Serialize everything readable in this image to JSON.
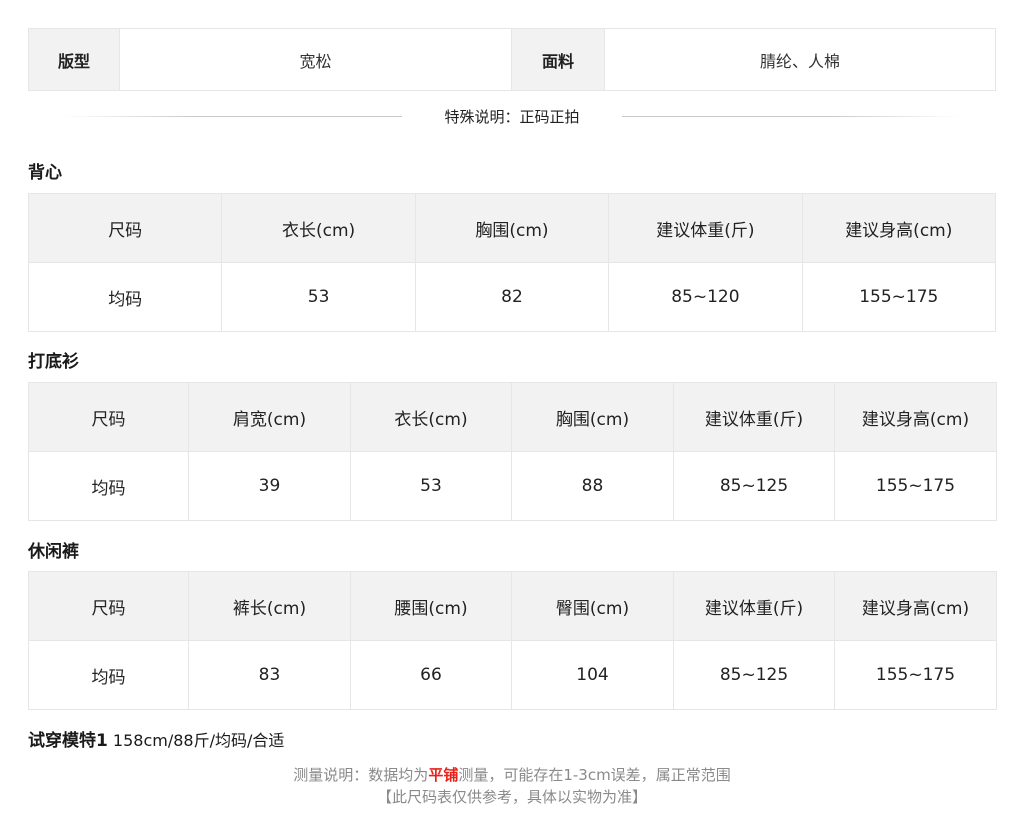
{
  "attributes": {
    "fit_label": "版型",
    "fit_value": "宽松",
    "fabric_label": "面料",
    "fabric_value": "腈纶、人棉"
  },
  "special_note": "特殊说明：正码正拍",
  "sections": [
    {
      "title": "背心",
      "headers": [
        "尺码",
        "衣长(cm)",
        "胸围(cm)",
        "建议体重(斤)",
        "建议身高(cm)"
      ],
      "row": [
        "均码",
        "53",
        "82",
        "85~120",
        "155~175"
      ]
    },
    {
      "title": "打底衫",
      "headers": [
        "尺码",
        "肩宽(cm)",
        "衣长(cm)",
        "胸围(cm)",
        "建议体重(斤)",
        "建议身高(cm)"
      ],
      "row": [
        "均码",
        "39",
        "53",
        "88",
        "85~125",
        "155~175"
      ]
    },
    {
      "title": "休闲裤",
      "headers": [
        "尺码",
        "裤长(cm)",
        "腰围(cm)",
        "臀围(cm)",
        "建议体重(斤)",
        "建议身高(cm)"
      ],
      "row": [
        "均码",
        "83",
        "66",
        "104",
        "85~125",
        "155~175"
      ]
    }
  ],
  "model": {
    "label": "试穿模特1",
    "detail": " 158cm/88斤/均码/合适"
  },
  "measure_note": {
    "prefix": "测量说明：数据均为",
    "highlight": "平铺",
    "suffix": "测量，可能存在1-3cm误差，属正常范围",
    "highlight_color": "#e8231a"
  },
  "reference_note": "【此尺码表仅供参考，具体以实物为准】"
}
